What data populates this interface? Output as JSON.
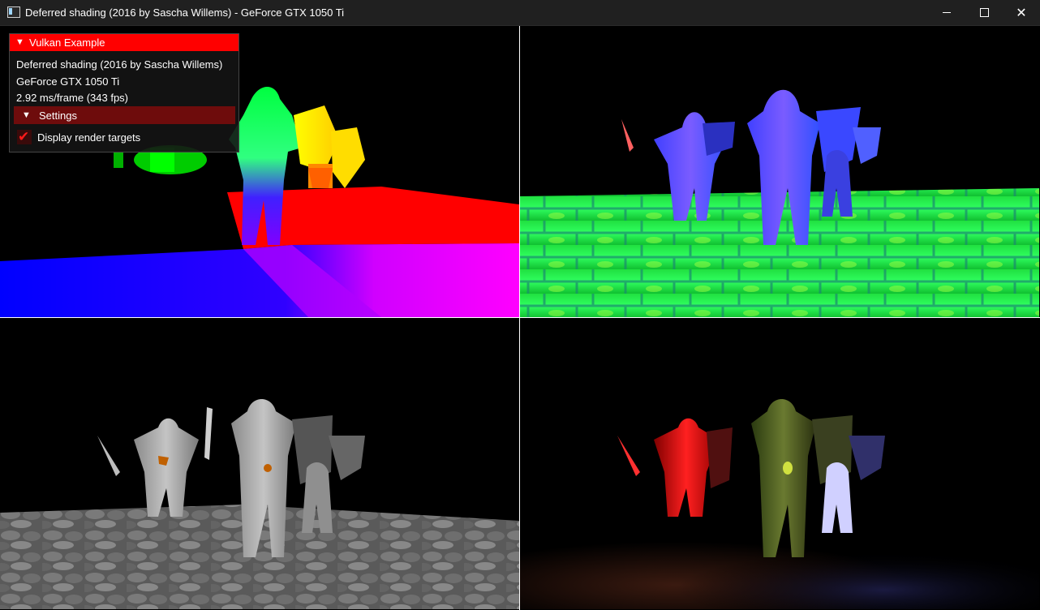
{
  "window": {
    "title": "Deferred shading (2016 by Sascha Willems) - GeForce GTX 1050 Ti",
    "controls": {
      "minimize": "minimize-icon",
      "maximize": "maximize-icon",
      "close": "close-icon"
    }
  },
  "overlay": {
    "title": "Vulkan Example",
    "title_color": "#ff0000",
    "lines": [
      "Deferred shading (2016 by Sascha Willems)",
      "GeForce GTX 1050 Ti",
      "2.92 ms/frame (343 fps)"
    ],
    "settings_label": "Settings",
    "checkbox_label": "Display render targets",
    "checkbox_checked": true
  },
  "render_targets": {
    "top_left": "position",
    "top_right": "normal",
    "bottom_left": "albedo",
    "bottom_right": "composition"
  }
}
